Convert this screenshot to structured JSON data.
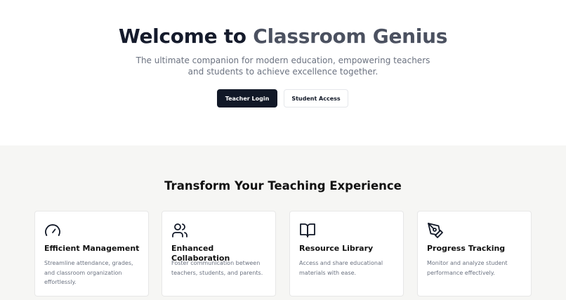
{
  "hero": {
    "title_part1": "Welcome to",
    "title_part2": "Classroom Genius",
    "subtitle": "The ultimate companion for modern education, empowering teachers and students to achieve excellence together.",
    "primary_button": "Teacher Login",
    "secondary_button": "Student Access"
  },
  "features": {
    "title": "Transform Your Teaching Experience",
    "cards": [
      {
        "icon": "gauge-icon",
        "title": "Efficient Management",
        "description": "Streamline attendance, grades, and classroom organization effortlessly."
      },
      {
        "icon": "users-icon",
        "title": "Enhanced Collaboration",
        "description": "Foster communication between teachers, students, and parents."
      },
      {
        "icon": "book-open-icon",
        "title": "Resource Library",
        "description": "Access and share educational materials with ease."
      },
      {
        "icon": "pen-tool-icon",
        "title": "Progress Tracking",
        "description": "Monitor and analyze student performance effectively."
      }
    ]
  },
  "colors": {
    "primary": "#111827",
    "features_background": "#f6f6f4",
    "muted_text": "#6b7280"
  }
}
